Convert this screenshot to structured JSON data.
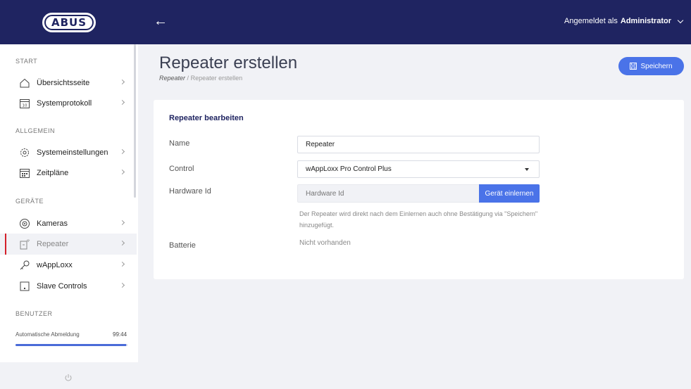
{
  "header": {
    "logo_text": "ABUS",
    "back_glyph": "←",
    "user_prefix": "Angemeldet als",
    "user_name": "Administrator"
  },
  "sidebar": {
    "sections": {
      "start": "START",
      "allgemein": "ALLGEMEIN",
      "geraete": "GERÄTE",
      "benutzer": "BENUTZER"
    },
    "items": [
      {
        "label": "Übersichtsseite",
        "icon": "home-icon"
      },
      {
        "label": "Systemprotokoll",
        "icon": "calendar-icon",
        "icon_text": "10"
      },
      {
        "label": "Systemeinstellungen",
        "icon": "gear-icon"
      },
      {
        "label": "Zeitpläne",
        "icon": "schedule-icon"
      },
      {
        "label": "Kameras",
        "icon": "camera-icon"
      },
      {
        "label": "Repeater",
        "icon": "repeater-icon",
        "active": true
      },
      {
        "label": "wAppLoxx",
        "icon": "key-icon"
      },
      {
        "label": "Slave Controls",
        "icon": "slave-control-icon"
      }
    ],
    "auto_logout_label": "Automatische Abmeldung",
    "auto_logout_time": "99:44",
    "auto_logout_progress": 0.99
  },
  "main": {
    "title": "Repeater erstellen",
    "breadcrumb": {
      "parent": "Repeater",
      "separator": "/",
      "current": "Repeater erstellen"
    },
    "save_label": "Speichern"
  },
  "form": {
    "title": "Repeater bearbeiten",
    "name_label": "Name",
    "name_value": "Repeater",
    "control_label": "Control",
    "control_value": "wAppLoxx Pro Control Plus",
    "hardware_label": "Hardware Id",
    "hardware_placeholder": "Hardware Id",
    "learn_label": "Gerät einlernen",
    "help_text": "Der Repeater wird direkt nach dem Einlernen auch ohne Bestätigung via \"Speichern\" hinzugefügt.",
    "battery_label": "Batterie",
    "battery_value": "Nicht vorhanden"
  },
  "colors": {
    "topbar": "#1f2461",
    "accent": "#4a73e8",
    "active_marker": "#d4202a",
    "background": "#f1f2f6"
  }
}
